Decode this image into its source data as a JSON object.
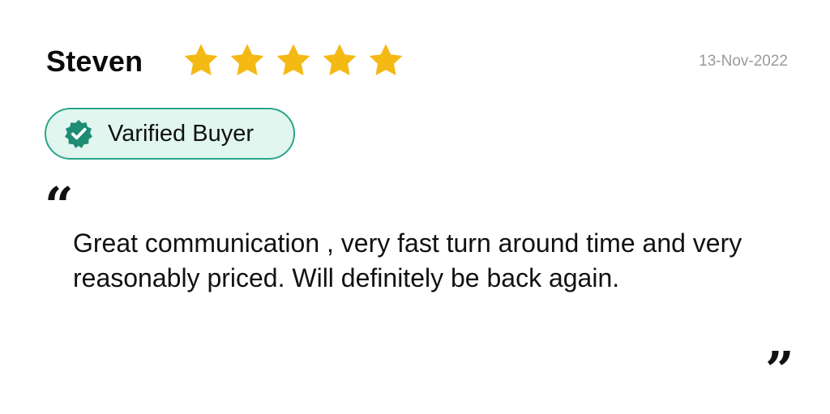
{
  "review": {
    "reviewer_name": "Steven",
    "rating": 5,
    "date": "13-Nov-2022",
    "badge_label": "Varified Buyer",
    "quote_open": "“",
    "quote_close": "”",
    "text": "Great communication , very fast turn around time and very reasonably priced. Will definitely be back again."
  },
  "icons": {
    "star": "star-icon",
    "verified": "verified-check-icon"
  },
  "colors": {
    "star": "#F5B914",
    "badge_border": "#2AA68B",
    "badge_fill": "#E0F6EF",
    "verified_icon": "#1F8C74",
    "date": "#9A9A9A"
  }
}
